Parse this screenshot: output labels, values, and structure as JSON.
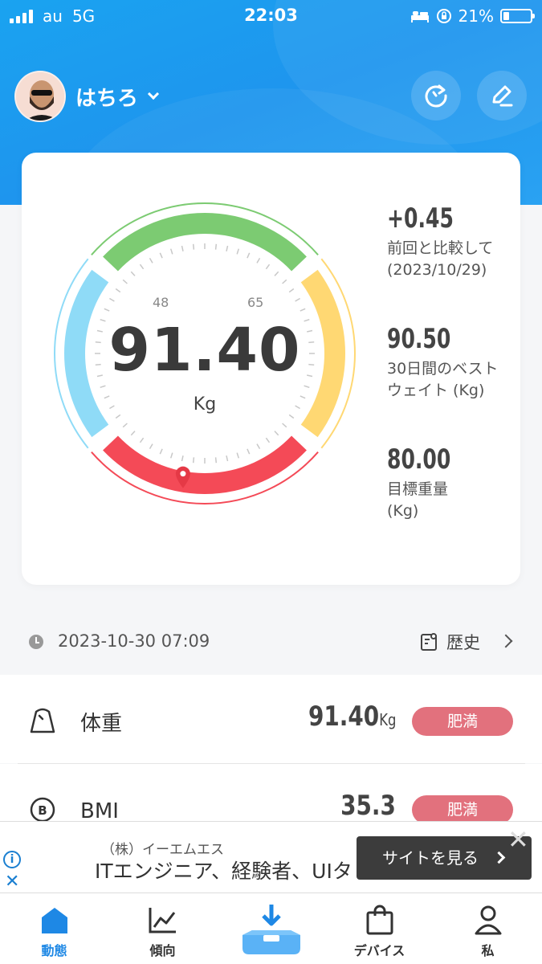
{
  "status_bar": {
    "carrier": "au",
    "network": "5G",
    "time": "22:03",
    "battery": "21%",
    "battery_level": 0.21
  },
  "header": {
    "user_name": "はちろ",
    "icons": [
      "refresh-icon",
      "edit-icon"
    ]
  },
  "gauge": {
    "value": "91.40",
    "unit": "Kg",
    "label_left": "48",
    "label_right": "65",
    "colors": {
      "green": "#7ccb72",
      "yellow": "#ffd873",
      "red": "#f44a57",
      "blue": "#8fdbf7"
    }
  },
  "stats": [
    {
      "value": "+0.45",
      "desc1": "前回と比較して",
      "desc2": "(2023/10/29)"
    },
    {
      "value": "90.50",
      "desc1": "30日間のベスト",
      "desc2": "ウェイト (Kg)"
    },
    {
      "value": "80.00",
      "desc1": "目標重量",
      "desc2": "(Kg)"
    }
  ],
  "record": {
    "datetime": "2023-10-30 07:09",
    "history_label": "歴史"
  },
  "metrics": [
    {
      "name": "体重",
      "value": "91.40",
      "unit": "Kg",
      "badge": "肥満"
    },
    {
      "name": "BMI",
      "value": "35.3",
      "unit": "",
      "badge": "肥満"
    }
  ],
  "ad": {
    "advertiser": "（株）イーエムエス",
    "headline": "ITエンジニア、経験者、UIタ",
    "cta": "サイトを見る"
  },
  "tabs": [
    {
      "label": "動態",
      "active": true
    },
    {
      "label": "傾向",
      "active": false
    },
    {
      "label": "",
      "active": false
    },
    {
      "label": "デバイス",
      "active": false
    },
    {
      "label": "私",
      "active": false
    }
  ],
  "colors": {
    "primary": "#1e96ee",
    "badge": "#e2717d",
    "tab_active": "#1e88e5"
  }
}
